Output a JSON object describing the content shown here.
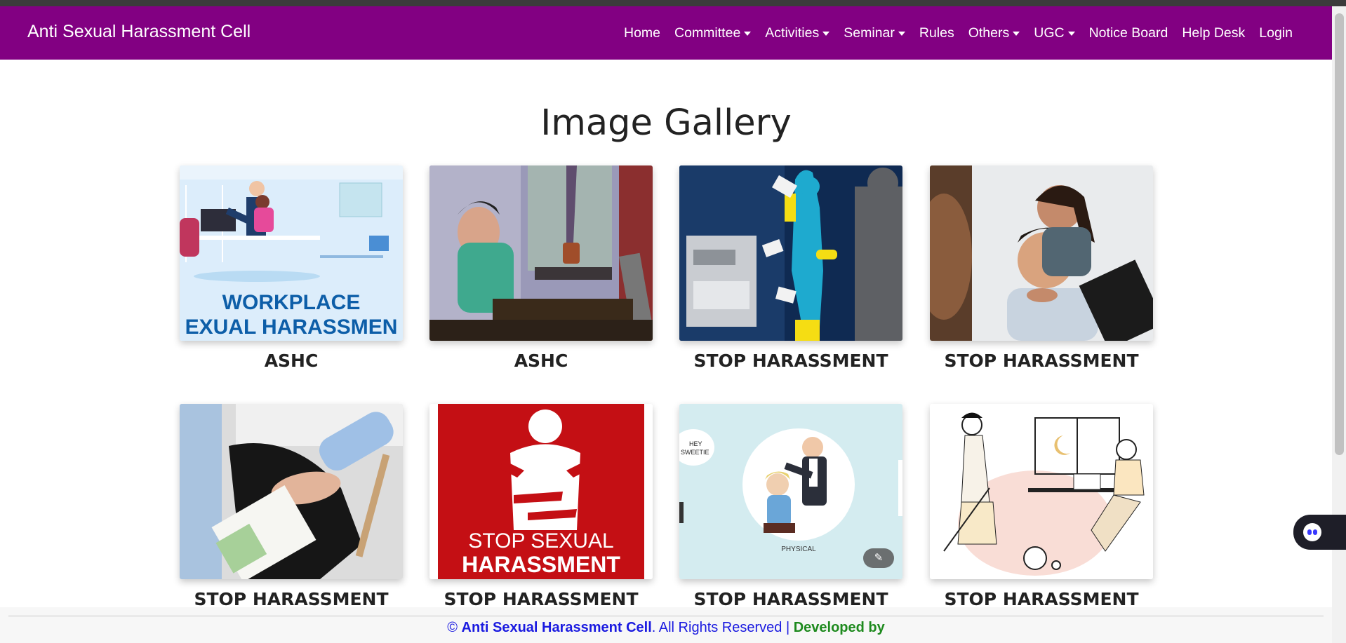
{
  "navbar": {
    "brand": "Anti Sexual Harassment Cell",
    "items": [
      {
        "label": "Home",
        "dropdown": false
      },
      {
        "label": "Committee",
        "dropdown": true
      },
      {
        "label": "Activities",
        "dropdown": true
      },
      {
        "label": "Seminar",
        "dropdown": true
      },
      {
        "label": "Rules",
        "dropdown": false
      },
      {
        "label": "Others",
        "dropdown": true
      },
      {
        "label": "UGC",
        "dropdown": true
      },
      {
        "label": "Notice Board",
        "dropdown": false
      },
      {
        "label": "Help Desk",
        "dropdown": false
      },
      {
        "label": "Login",
        "dropdown": false
      }
    ]
  },
  "gallery": {
    "title": "Image Gallery",
    "items": [
      {
        "caption": "ASHC",
        "image_text": [
          "WORKPLACE",
          "EXUAL HARASSMEN"
        ]
      },
      {
        "caption": "ASHC"
      },
      {
        "caption": "STOP HARASSMENT"
      },
      {
        "caption": "STOP HARASSMENT"
      },
      {
        "caption": "STOP HARASSMENT"
      },
      {
        "caption": "STOP HARASSMENT",
        "image_text": [
          "STOP SEXUAL",
          "HARASSMENT"
        ]
      },
      {
        "caption": "STOP HARASSMENT",
        "image_text": [
          "HEY",
          "SWEETIE",
          "PHYSICAL"
        ]
      },
      {
        "caption": "STOP HARASSMENT"
      }
    ]
  },
  "footer": {
    "copyright": "©",
    "org": "Anti Sexual Harassment Cell",
    "rights": ". All Rights Reserved |",
    "developed": "Developed by"
  },
  "colors": {
    "navbar_bg": "#820082",
    "footer_link": "#1a1ae0",
    "footer_developed": "#1e8a1e"
  }
}
